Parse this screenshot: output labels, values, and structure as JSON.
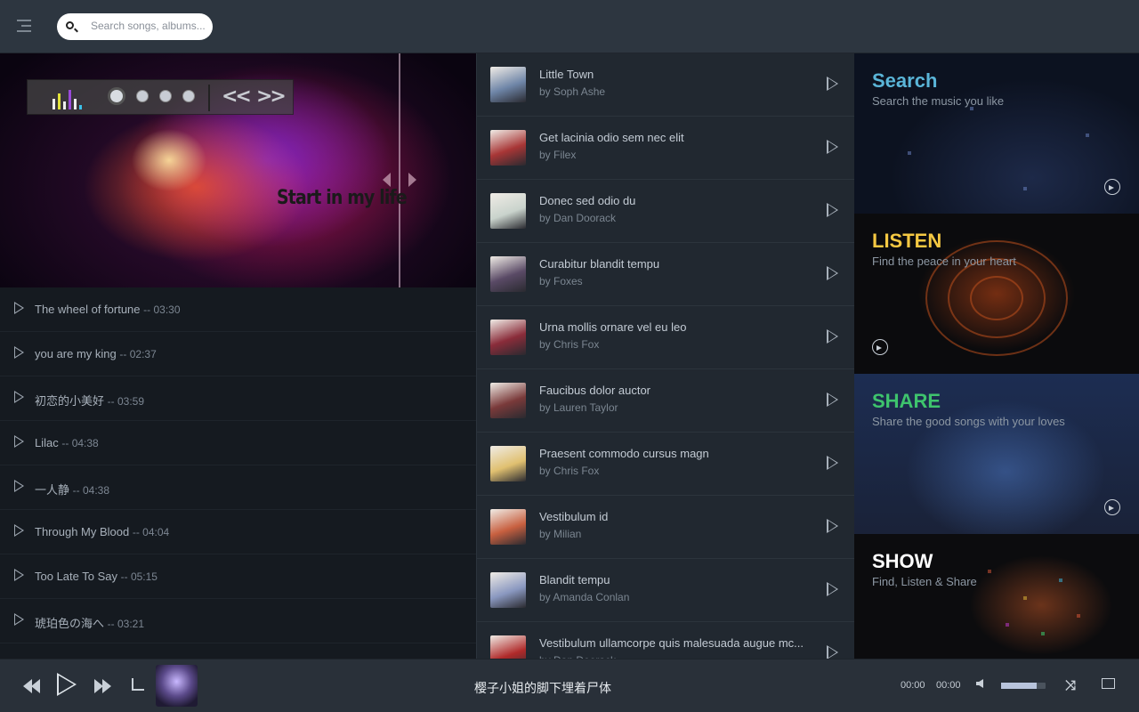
{
  "topbar": {
    "search_placeholder": "Search songs, albums..."
  },
  "hero": {
    "title": "Start in my life",
    "slides": 4,
    "active_slide": 1
  },
  "playlist": [
    {
      "name": "The wheel of fortune",
      "duration": "-- 03:30"
    },
    {
      "name": "you are my king",
      "duration": "-- 02:37"
    },
    {
      "name": "初恋的小美好",
      "duration": "-- 03:59"
    },
    {
      "name": "Lilac",
      "duration": "-- 04:38"
    },
    {
      "name": "一人静",
      "duration": "-- 04:38"
    },
    {
      "name": "Through My Blood",
      "duration": "-- 04:04"
    },
    {
      "name": "Too Late To Say",
      "duration": "-- 05:15"
    },
    {
      "name": "琥珀色の海へ",
      "duration": "-- 03:21"
    }
  ],
  "tracks": [
    {
      "title": "Little Town",
      "artist": "by Soph Ashe",
      "color": "#6f86a8"
    },
    {
      "title": "Get lacinia odio sem nec elit",
      "artist": "by Filex",
      "color": "#a83636"
    },
    {
      "title": "Donec sed odio du",
      "artist": "by Dan Doorack",
      "color": "#c9d3cc"
    },
    {
      "title": "Curabitur blandit tempu",
      "artist": "by Foxes",
      "color": "#5a4a66"
    },
    {
      "title": "Urna mollis ornare vel eu leo",
      "artist": "by Chris Fox",
      "color": "#8a2c3a"
    },
    {
      "title": "Faucibus dolor auctor",
      "artist": "by Lauren Taylor",
      "color": "#7a3a3a"
    },
    {
      "title": "Praesent commodo cursus magn",
      "artist": "by Chris Fox",
      "color": "#e0c070"
    },
    {
      "title": "Vestibulum id",
      "artist": "by Milian",
      "color": "#c86040"
    },
    {
      "title": "Blandit tempu",
      "artist": "by Amanda Conlan",
      "color": "#8a98c0"
    },
    {
      "title": "Vestibulum ullamcorpe quis malesuada augue mc...",
      "artist": "by Dan Doorack",
      "color": "#b02a2a"
    }
  ],
  "features": {
    "search": {
      "title": "Search",
      "subtitle": "Search the music you like",
      "color": "#5ab5d8"
    },
    "listen": {
      "title": "LISTEN",
      "subtitle": "Find the peace in your heart",
      "color": "#f5c842"
    },
    "share": {
      "title": "SHARE",
      "subtitle": "Share the good songs with your loves",
      "color": "#3ec46d"
    },
    "show": {
      "title": "SHOW",
      "subtitle": "Find, Listen & Share",
      "color": "#ffffff"
    }
  },
  "player": {
    "now_playing": "樱子小姐的脚下埋着尸体",
    "current_time": "00:00",
    "total_time": "00:00",
    "volume": 0.8
  }
}
